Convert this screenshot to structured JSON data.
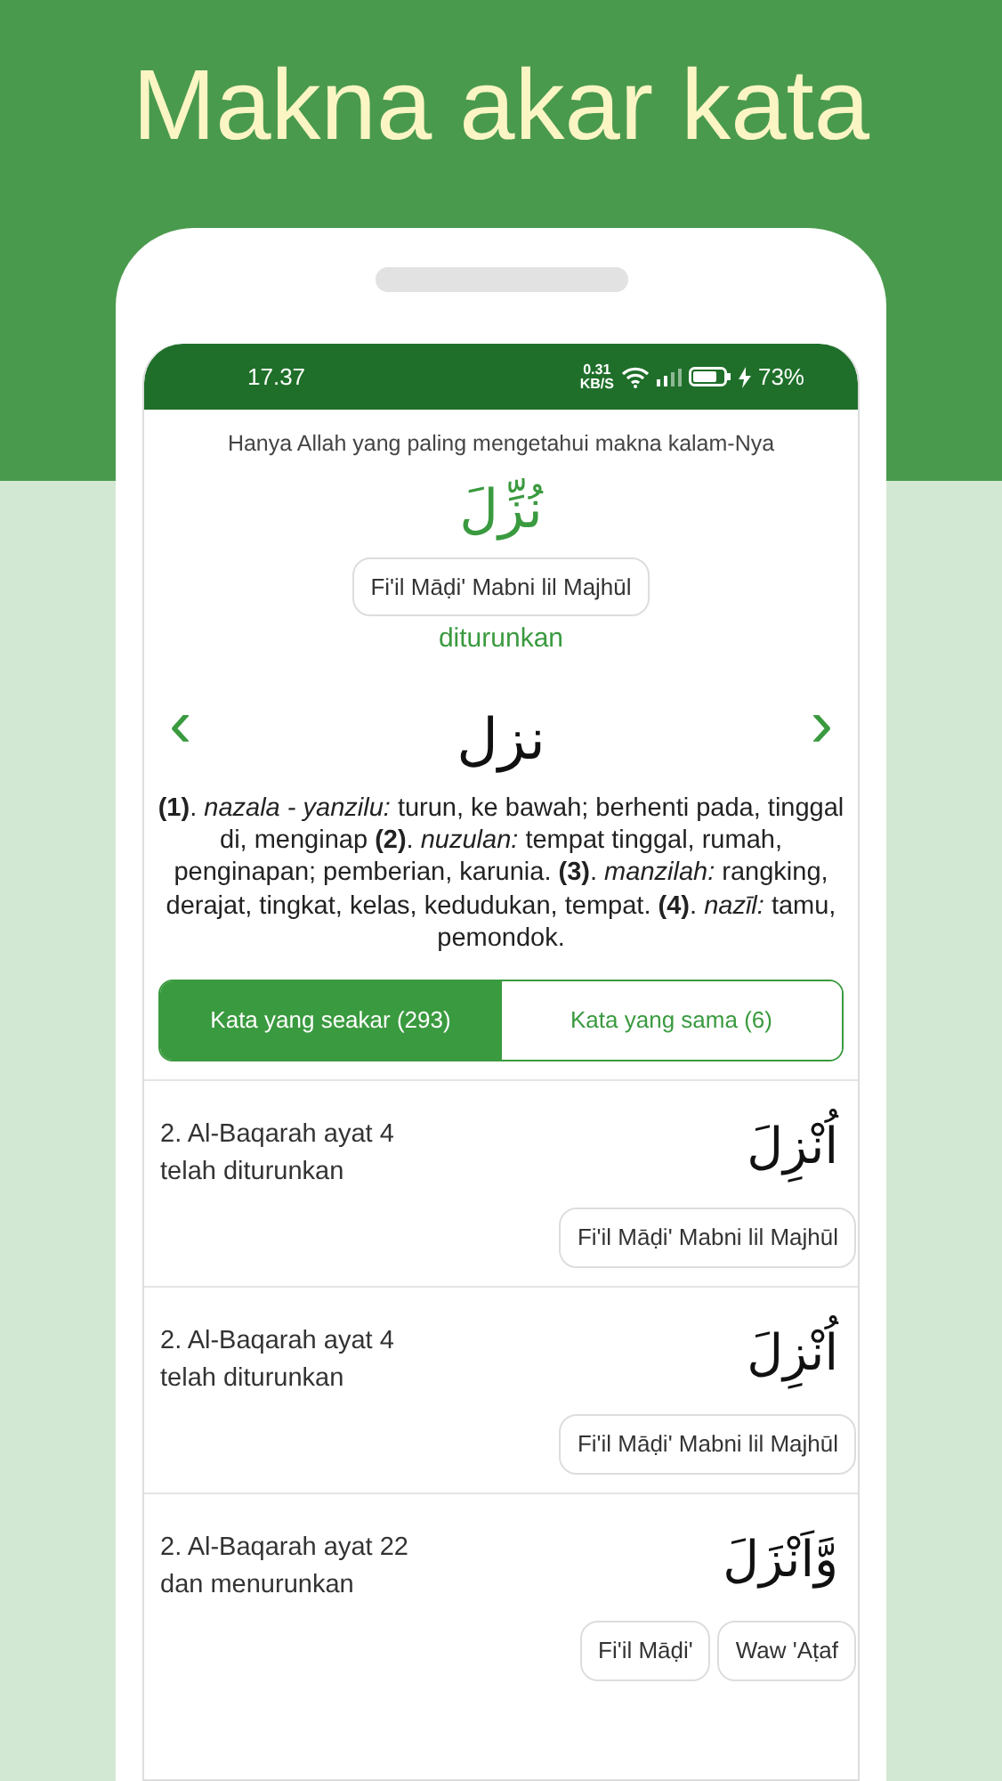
{
  "headline": "Makna akar kata",
  "status_bar": {
    "time": "17.37",
    "speed": "0.31",
    "speed_unit": "KB/S",
    "battery": "73%"
  },
  "disclaimer": "Hanya Allah yang paling mengetahui makna kalam-Nya",
  "word": {
    "arabic": "نُزِّلَ",
    "tag": "Fi'il Māḍi' Mabni lil Majhūl",
    "meaning": "diturunkan"
  },
  "root": {
    "arabic": "نزل",
    "prev": "‹",
    "next": "›"
  },
  "definition": "**(1)**. *nazala - yanzilu:* turun, ke bawah; berhenti pada, tinggal di, menginap **(2)**. *nuzulan:* tempat tinggal, rumah, penginapan; pemberian, karunia. **(3)**. *manzilah:* rangking, derajat, tingkat, kelas, kedudukan, tempat. **(4)**. *nazīl:* tamu, pemondok.",
  "tabs": [
    {
      "label": "Kata yang seakar (293)",
      "selected": true
    },
    {
      "label": "Kata yang sama (6)",
      "selected": false
    }
  ],
  "results": [
    {
      "reference": "2. Al-Baqarah ayat 4",
      "meaning": "telah diturunkan",
      "arabic": "اُنْزِلَ",
      "tags": [
        "Fi'il Māḍi' Mabni lil Majhūl"
      ]
    },
    {
      "reference": "2. Al-Baqarah ayat 4",
      "meaning": "telah diturunkan",
      "arabic": "اُنْزِلَ",
      "tags": [
        "Fi'il Māḍi' Mabni lil Majhūl"
      ]
    },
    {
      "reference": "2. Al-Baqarah ayat 22",
      "meaning": "dan menurunkan",
      "arabic": "وَّاَنْزَلَ",
      "tags": [
        "Fi'il Māḍi'",
        "Waw 'Aṭaf"
      ]
    }
  ]
}
